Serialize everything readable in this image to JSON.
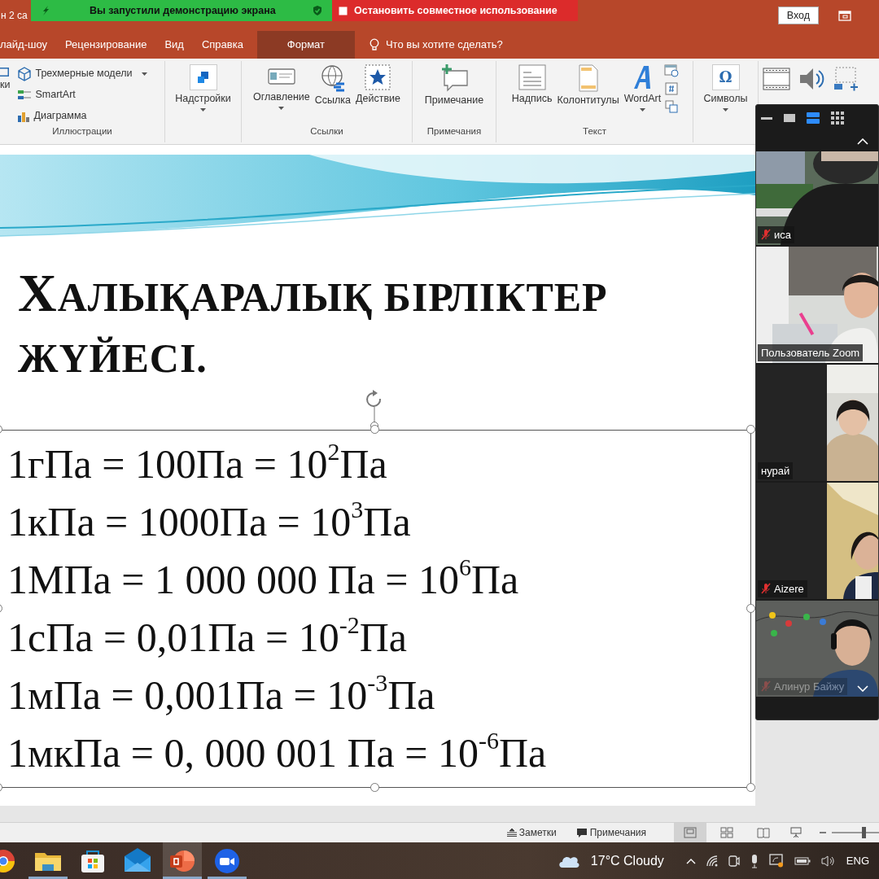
{
  "title_bar": {
    "document_title": "н 2 са",
    "share_notice": "Вы запустили демонстрацию экрана",
    "stop_share": "Остановить совместное использование",
    "sign_in": "Вход"
  },
  "tabs": [
    {
      "label": "лайд-шоу",
      "selected": false
    },
    {
      "label": "Рецензирование",
      "selected": false
    },
    {
      "label": "Вид",
      "selected": false
    },
    {
      "label": "Справка",
      "selected": false
    },
    {
      "label": "Формат",
      "selected": true
    }
  ],
  "tell_me": {
    "placeholder": "Что вы хотите сделать?"
  },
  "ribbon": {
    "groups": [
      {
        "label": "Иллюстрации",
        "items": [
          {
            "label": "ки",
            "kind": "cut"
          },
          {
            "label": "Трехмерные модели",
            "kind": "small",
            "dropdown": true
          },
          {
            "label": "SmartArt",
            "kind": "small",
            "dropdown": false
          },
          {
            "label": "Диаграмма",
            "kind": "small",
            "dropdown": false
          }
        ]
      },
      {
        "items": [
          {
            "label": "Надстройки",
            "kind": "large",
            "dropdown": true
          }
        ]
      },
      {
        "label": "Ссылки",
        "items": [
          {
            "label": "Оглавление",
            "kind": "large",
            "dropdown": true
          },
          {
            "label": "Ссылка",
            "kind": "large",
            "dropdown": false
          },
          {
            "label": "Действие",
            "kind": "large",
            "dropdown": false
          }
        ]
      },
      {
        "label": "Примечания",
        "items": [
          {
            "label": "Примечание",
            "kind": "large",
            "dropdown": false
          }
        ]
      },
      {
        "label": "Текст",
        "items": [
          {
            "label": "Надпись",
            "kind": "large",
            "dropdown": false
          },
          {
            "label": "Колонтитулы",
            "kind": "large",
            "dropdown": false
          },
          {
            "label": "WordArt",
            "kind": "large",
            "dropdown": true
          },
          {
            "kind": "icon"
          },
          {
            "kind": "icon"
          },
          {
            "kind": "icon"
          }
        ]
      },
      {
        "items": [
          {
            "label": "Символы",
            "kind": "large",
            "dropdown": true,
            "glyph": "Ω"
          }
        ]
      },
      {
        "items": [
          {
            "kind": "media"
          },
          {
            "kind": "media"
          },
          {
            "kind": "media"
          }
        ]
      }
    ]
  },
  "slide": {
    "title": "ХАЛЫҚАРАЛЫҚ БІРЛІКТЕР ЖҮЙЕСІ.",
    "lines": [
      "1гПа = 100Па = 10$^{2}$Па",
      "1кПа = 1000Па = 10$^{3}$Па",
      "1МПа = 1 000 000 Па = 10$^{6}$Па",
      "1сПа = 0,01Па = 10$^{-2}$Па",
      "1мПа = 0,001Па = 10$^{-3}$Па",
      "1мкПа = 0, 000 001 Па = 10$^{-6}$Па"
    ]
  },
  "zoom_panel": {
    "toolbar": [
      {
        "selected": false
      },
      {
        "selected": false
      },
      {
        "selected": true
      },
      {
        "selected": false
      }
    ],
    "tiles": [
      {
        "name": "иса",
        "muted": true,
        "kind": "full"
      },
      {
        "name": "Пользователь Zoom",
        "muted": false,
        "kind": "full"
      },
      {
        "name": "нурай",
        "muted": false,
        "kind": "split"
      },
      {
        "name": "Aizere",
        "muted": true,
        "kind": "split"
      },
      {
        "name": "Алинур Байжу",
        "muted": true,
        "kind": "full"
      }
    ]
  },
  "status_bar": {
    "notes": "Заметки",
    "comments": "Примечания",
    "views": [
      {
        "selected": true
      },
      {
        "selected": false
      },
      {
        "selected": false
      }
    ],
    "zoom": {
      "level": 0.7
    }
  },
  "taskbar": {
    "apps": [
      {
        "selected": false,
        "running": false
      },
      {
        "selected": false,
        "running": true
      },
      {
        "selected": false,
        "running": false
      },
      {
        "selected": false,
        "running": false
      },
      {
        "selected": true,
        "running": true
      },
      {
        "selected": false,
        "running": true
      }
    ],
    "weather": "17°C Cloudy",
    "language": "ENG"
  }
}
